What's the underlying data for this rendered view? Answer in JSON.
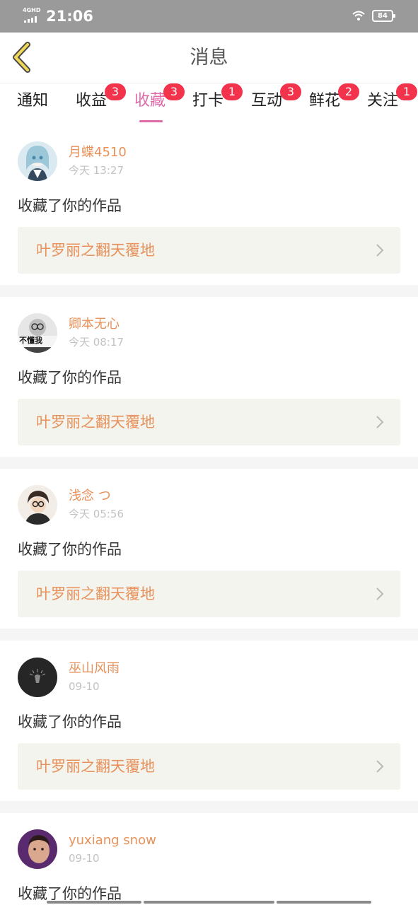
{
  "status_bar": {
    "network": "4GHD",
    "time": "21:06",
    "battery": "84"
  },
  "header": {
    "title": "消息",
    "back_icon": "back-arrow-icon"
  },
  "tabs": [
    {
      "label": "通知",
      "badge": ""
    },
    {
      "label": "收益",
      "badge": "3"
    },
    {
      "label": "收藏",
      "badge": "3",
      "active": true
    },
    {
      "label": "打卡",
      "badge": "1"
    },
    {
      "label": "互动",
      "badge": "3"
    },
    {
      "label": "鲜花",
      "badge": "2"
    },
    {
      "label": "关注",
      "badge": "1"
    }
  ],
  "colors": {
    "accent": "#e06aa8",
    "name": "#e8915a",
    "badge": "#f2334b",
    "muted": "#c2c2c2"
  },
  "feed": [
    {
      "user": "月蝶4510",
      "time": "今天 13:27",
      "action": "收藏了你的作品",
      "work": "叶罗丽之翻天覆地"
    },
    {
      "user": "卿本无心",
      "time": "今天 08:17",
      "action": "收藏了你的作品",
      "work": "叶罗丽之翻天覆地",
      "avatar_text": "不懂我"
    },
    {
      "user": "浅念 つ",
      "time": "今天 05:56",
      "action": "收藏了你的作品",
      "work": "叶罗丽之翻天覆地"
    },
    {
      "user": "巫山风雨",
      "time": "09-10",
      "action": "收藏了你的作品",
      "work": "叶罗丽之翻天覆地"
    },
    {
      "user": "yuxiang snow",
      "time": "09-10",
      "action": "收藏了你的作品"
    }
  ]
}
